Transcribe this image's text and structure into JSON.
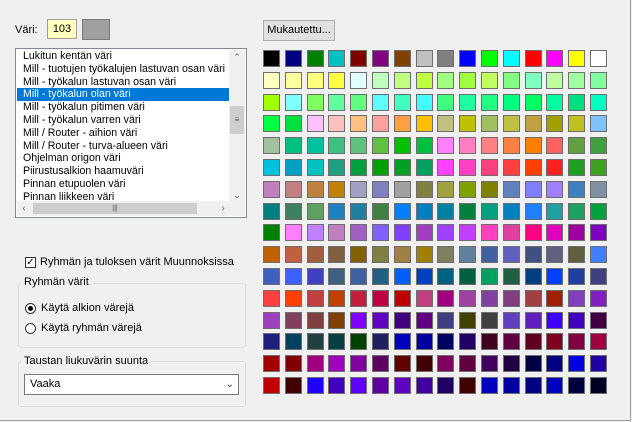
{
  "vari": {
    "label": "Väri:",
    "value": "103",
    "swatch_color": "#a0a0a0"
  },
  "custom_button": "Mukautettu...",
  "object_list": {
    "items": [
      "Lukitun kentän väri",
      "Mill - tuotujen työkalujen lastuvan osan väri",
      "Mill - työkalun lastuvan osan väri",
      "Mill - työkalun olan väri",
      "Mill - työkalun pitimen väri",
      "Mill - työkalun varren väri",
      "Mill / Router - aihion väri",
      "Mill / Router - turva-alueen väri",
      "Ohjelman origon väri",
      "Piirustusalkion haamuväri",
      "Pinnan etupuolen väri",
      "Pinnan liikkeen väri"
    ],
    "selected_index": 3
  },
  "checkbox": {
    "label": "Ryhmän ja tuloksen värit Muunnoksissa",
    "checked": true
  },
  "group_colors": {
    "title": "Ryhmän värit",
    "options": [
      "Käytä alkion värejä",
      "Käytä ryhmän värejä"
    ],
    "selected": 0
  },
  "gradient": {
    "title": "Taustan liukuvärin suunta",
    "value": "Vaaka"
  },
  "palette": [
    [
      "#000000",
      "#000080",
      "#008000",
      "#00c0c0",
      "#800000",
      "#800080",
      "#804000",
      "#c0c0c0",
      "#808080",
      "#0000ff",
      "#00ff00",
      "#00ffff",
      "#ff0000",
      "#ff00ff",
      "#ffff00",
      "#ffffff"
    ],
    [
      "#ffffc0",
      "#ffffa0",
      "#ffff80",
      "#ffff40",
      "#e0ffff",
      "#c0ffc0",
      "#c0ff80",
      "#c0ff40",
      "#a0ff80",
      "#a0ff40",
      "#c0ff60",
      "#80ff80",
      "#80ffc0",
      "#c0ffa0",
      "#a0ffa0",
      "#80ffa0"
    ],
    [
      "#a0ff00",
      "#80ffff",
      "#80ff60",
      "#60ffa0",
      "#60ff80",
      "#60ffff",
      "#40ffc0",
      "#40ffff",
      "#40ff80",
      "#20ffa0",
      "#20ff80",
      "#00ff80",
      "#00ff60",
      "#00ffa0",
      "#00e080",
      "#00ffc0"
    ],
    [
      "#00ff40",
      "#00e040",
      "#ffc0ff",
      "#ffc0c0",
      "#ffc080",
      "#ffa0a0",
      "#ffa040",
      "#ffc000",
      "#c0c080",
      "#c0c000",
      "#a0c060",
      "#c0c040",
      "#c0a040",
      "#a0a000",
      "#c0c020",
      "#80c0ff"
    ],
    [
      "#a0c0a0",
      "#00c080",
      "#00c0a0",
      "#40c080",
      "#60c080",
      "#60c040",
      "#00c000",
      "#00c040",
      "#ff80ff",
      "#ff80c0",
      "#ff8080",
      "#ff8040",
      "#ff8000",
      "#ff6060",
      "#60a040",
      "#40a040"
    ],
    [
      "#00c0e0",
      "#00a0c0",
      "#00c0c0",
      "#20a080",
      "#00a040",
      "#00a000",
      "#00a020",
      "#00a060",
      "#ff40ff",
      "#ff40c0",
      "#ff4080",
      "#ff4040",
      "#ff4000",
      "#ff2020",
      "#20a020",
      "#40a020"
    ],
    [
      "#c080c0",
      "#c08080",
      "#c08040",
      "#c08000",
      "#a0a0c0",
      "#8080c0",
      "#a0a0a0",
      "#808040",
      "#a0a040",
      "#80a000",
      "#808000",
      "#6080c0",
      "#8080ff",
      "#a080ff",
      "#4080c0",
      "#8090a0"
    ],
    [
      "#008080",
      "#408060",
      "#60a060",
      "#2080c0",
      "#2080a0",
      "#408040",
      "#0080ff",
      "#0080c0",
      "#0080a0",
      "#008040",
      "#00a080",
      "#0080c0",
      "#2080ff",
      "#20a0a0",
      "#20a060",
      "#00a040"
    ],
    [
      "#008000",
      "#ff80ff",
      "#c080ff",
      "#c080c0",
      "#a060c0",
      "#8060ff",
      "#8040ff",
      "#a040c0",
      "#a040ff",
      "#c040ff",
      "#ff40c0",
      "#e040a0",
      "#ff0080",
      "#e000c0",
      "#a000a0",
      "#8000c0"
    ],
    [
      "#c06000",
      "#c06040",
      "#a06040",
      "#806040",
      "#806000",
      "#808040",
      "#a08040",
      "#a08000",
      "#808060",
      "#6080a0",
      "#4060a0",
      "#6060c0",
      "#405080",
      "#606080",
      "#606040",
      "#4080ff"
    ],
    [
      "#4060c0",
      "#4060ff",
      "#4040c0",
      "#406080",
      "#4060a0",
      "#206080",
      "#0060ff",
      "#0040c0",
      "#006080",
      "#006040",
      "#00a060",
      "#206040",
      "#004080",
      "#0040ff",
      "#2040a0",
      "#404080"
    ],
    [
      "#ff4040",
      "#ff4000",
      "#c04040",
      "#c04000",
      "#c02040",
      "#c00040",
      "#c00000",
      "#c04080",
      "#a00080",
      "#a040a0",
      "#8040a0",
      "#804080",
      "#a04040",
      "#a02000",
      "#8040c0",
      "#8020c0"
    ],
    [
      "#a040c0",
      "#804060",
      "#804040",
      "#804000",
      "#8000ff",
      "#6000c0",
      "#400080",
      "#600080",
      "#404080",
      "#404000",
      "#404040",
      "#6040c0",
      "#6020c0",
      "#4000ff",
      "#4000c0",
      "#400040"
    ],
    [
      "#202080",
      "#004060",
      "#204040",
      "#004040",
      "#004000",
      "#202060",
      "#0000c0",
      "#0000a0",
      "#000060",
      "#200060",
      "#400020",
      "#600040",
      "#600020",
      "#800020",
      "#800040",
      "#a00040"
    ],
    [
      "#a00000",
      "#800000",
      "#a00080",
      "#a000c0",
      "#8000a0",
      "#600060",
      "#600000",
      "#400000",
      "#800060",
      "#600040",
      "#400060",
      "#200040",
      "#000040",
      "#000080",
      "#0000e0",
      "#2000a0"
    ],
    [
      "#c00000",
      "#400000",
      "#2000ff",
      "#4000c0",
      "#6000ff",
      "#6000a0",
      "#6000c0",
      "#4000a0",
      "#200060",
      "#400000",
      "#0000c0",
      "#0000a0",
      "#000080",
      "#0000c0",
      "#000040",
      "#000020"
    ]
  ]
}
